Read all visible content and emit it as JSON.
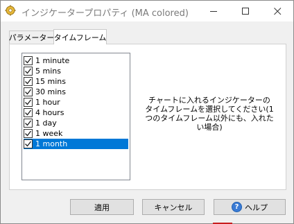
{
  "window": {
    "title": "インジケータープロパティ (MA colored)"
  },
  "tabs": [
    {
      "label": "パラメーター"
    },
    {
      "label": "タイムフレーム"
    }
  ],
  "timeframes": [
    {
      "label": "1 minute",
      "checked": true
    },
    {
      "label": "5 mins",
      "checked": true
    },
    {
      "label": "15 mins",
      "checked": true
    },
    {
      "label": "30 mins",
      "checked": true
    },
    {
      "label": "1 hour",
      "checked": true
    },
    {
      "label": "4 hours",
      "checked": true
    },
    {
      "label": "1 day",
      "checked": true
    },
    {
      "label": "1 week",
      "checked": true
    },
    {
      "label": "1 month",
      "checked": true,
      "selected": true
    }
  ],
  "info": {
    "text": "チャートに入れるインジケーターのタイムフレームを選択してください(1つのタイムフレーム以外にも、入れたい場合)"
  },
  "buttons": {
    "apply": "適用",
    "cancel": "キャンセル",
    "help": "ヘルプ"
  },
  "colors": {
    "selection": "#0078d7",
    "accent_red": "#c81e1e"
  }
}
